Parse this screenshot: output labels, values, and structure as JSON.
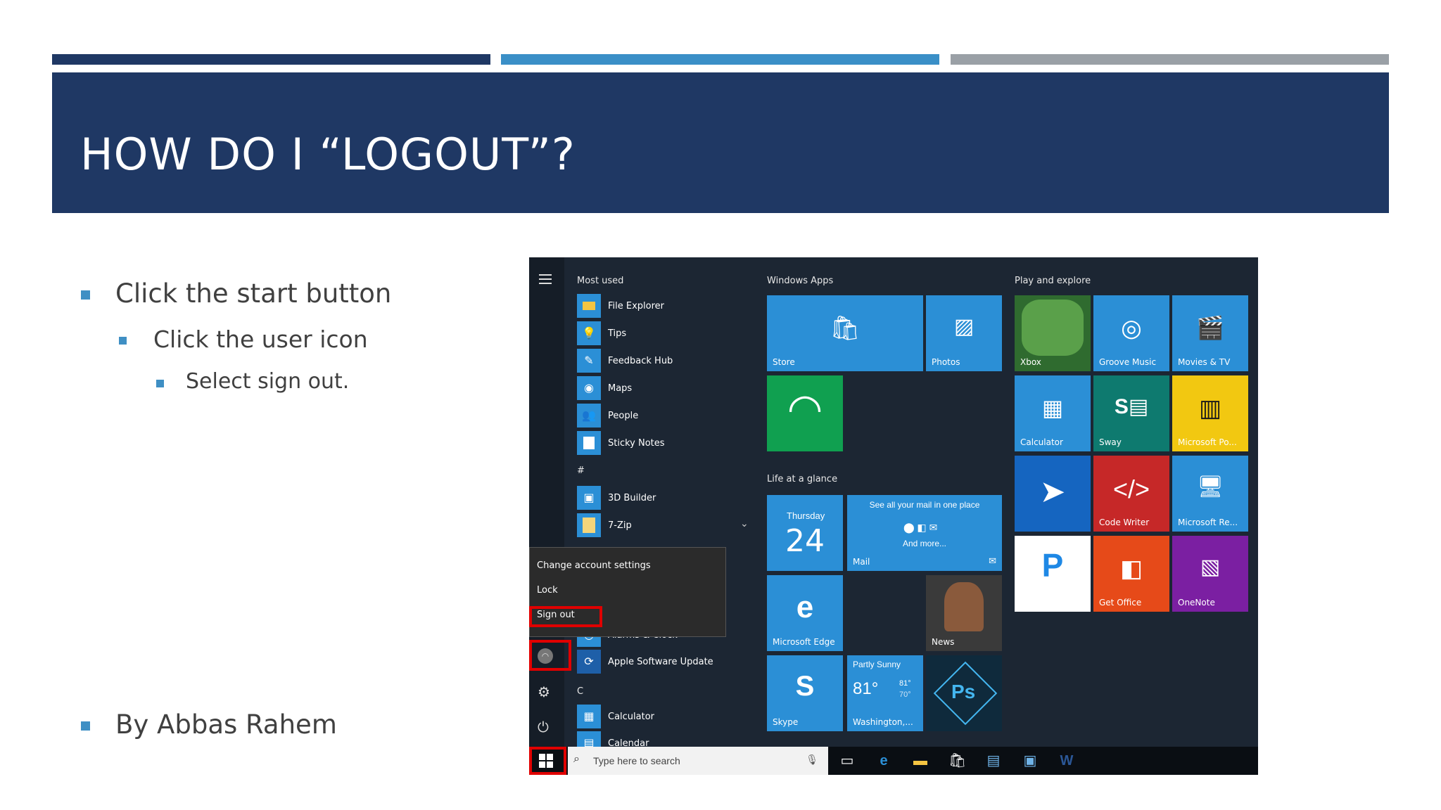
{
  "slide": {
    "title": "HOW DO I “LOGOUT”?",
    "bullets": [
      "Click the start button",
      "Click the user icon",
      "Select sign out.",
      "By Abbas Rahem"
    ]
  },
  "colors": {
    "stripe_dark": "#1f3864",
    "stripe_blue": "#3a8fc7",
    "stripe_gray": "#9aa0a6",
    "banner": "#1f3864",
    "bullet": "#3f8fc4",
    "tile_blue": "#2b8fd6",
    "highlight": "#e00000"
  },
  "start_menu": {
    "most_used_header": "Most used",
    "most_used": [
      {
        "label": "File Explorer",
        "icon": "folder-icon"
      },
      {
        "label": "Tips",
        "icon": "lightbulb-icon"
      },
      {
        "label": "Feedback Hub",
        "icon": "feedback-icon"
      },
      {
        "label": "Maps",
        "icon": "maps-icon"
      },
      {
        "label": "People",
        "icon": "people-icon"
      },
      {
        "label": "Sticky Notes",
        "icon": "sticky-notes-icon"
      }
    ],
    "hash_header": "#",
    "hash_items": [
      {
        "label": "3D Builder",
        "icon": "3d-builder-icon"
      },
      {
        "label": "7-Zip",
        "icon": "folder-icon"
      }
    ],
    "a_items": [
      {
        "label": "Alarms & Clock",
        "icon": "clock-icon"
      },
      {
        "label": "Apple Software Update",
        "icon": "apple-update-icon"
      }
    ],
    "c_header": "C",
    "c_items": [
      {
        "label": "Calculator",
        "icon": "calculator-icon"
      },
      {
        "label": "Calendar",
        "icon": "calendar-icon"
      }
    ],
    "account_popup": {
      "change": "Change account settings",
      "lock": "Lock",
      "signout": "Sign out"
    },
    "groups": {
      "windows_apps": "Windows Apps",
      "life": "Life at a glance",
      "play": "Play and explore"
    },
    "tiles": {
      "store": "Store",
      "photos": "Photos",
      "xbox": "Xbox",
      "groove": "Groove Music",
      "movies": "Movies & TV",
      "calculator": "Calculator",
      "sway": "Sway",
      "powerbi": "Microsoft Po...",
      "code_writer": "Code Writer",
      "remote": "Microsoft Re...",
      "get_office": "Get Office",
      "onenote": "OneNote",
      "edge": "Microsoft Edge",
      "news": "News",
      "skype": "Skype",
      "calendar_day": "Thursday",
      "calendar_date": "24",
      "mail_line1": "See all your mail in one place",
      "mail_line2": "And more...",
      "mail": "Mail",
      "weather_cond": "Partly Sunny",
      "weather_temp": "81°",
      "weather_hi": "81°",
      "weather_lo": "70°",
      "weather_loc": "Washington,..."
    },
    "search_placeholder": "Type here to search"
  }
}
